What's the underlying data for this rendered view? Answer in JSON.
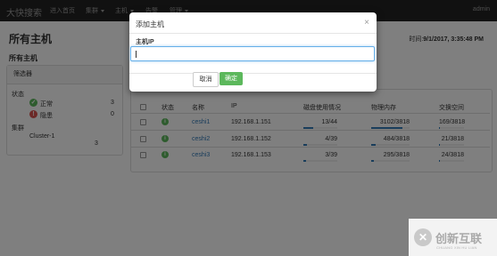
{
  "navbar": {
    "brand": "大快搜索",
    "items": [
      {
        "label": "进入首页",
        "dropdown": false
      },
      {
        "label": "集群",
        "dropdown": true
      },
      {
        "label": "主机",
        "dropdown": true
      },
      {
        "label": "告警",
        "dropdown": false
      },
      {
        "label": "管理",
        "dropdown": true
      }
    ],
    "user": "admin"
  },
  "page": {
    "title": "所有主机",
    "time_label": "时间:",
    "time_value": "9/1/2017, 3:35:48 PM",
    "subtitle": "所有主机"
  },
  "filter": {
    "header": "筛选器",
    "status_label": "状态",
    "statuses": [
      {
        "label": "正常",
        "count": "3",
        "icon": "check-icon",
        "color": "#5cb85c"
      },
      {
        "label": "隐患",
        "count": "0",
        "icon": "alert-icon",
        "color": "#d9534f"
      }
    ],
    "cluster_label": "集群",
    "cluster_name": "Cluster-1",
    "cluster_count": "3"
  },
  "hosts": {
    "columns": [
      "状态",
      "名称",
      "IP",
      "磁盘使用情况",
      "物理内存",
      "交换空间"
    ],
    "rows": [
      {
        "name": "ceshi1",
        "ip": "192.168.1.151",
        "disk": "13/44",
        "disk_pct": 0.295,
        "mem": "3102/3818",
        "mem_pct": 0.812,
        "swap": "169/3818",
        "swap_pct": 0.044
      },
      {
        "name": "ceshi2",
        "ip": "192.168.1.152",
        "disk": "4/39",
        "disk_pct": 0.103,
        "mem": "484/3818",
        "mem_pct": 0.127,
        "swap": "21/3818",
        "swap_pct": 0.006
      },
      {
        "name": "ceshi3",
        "ip": "192.168.1.153",
        "disk": "3/39",
        "disk_pct": 0.077,
        "mem": "295/3818",
        "mem_pct": 0.077,
        "swap": "24/3818",
        "swap_pct": 0.006
      }
    ]
  },
  "modal": {
    "title": "添加主机",
    "close": "×",
    "field_label": "主机IP",
    "input_value": "",
    "cancel_label": "取消",
    "confirm_label": "确定"
  },
  "watermark": {
    "logo_glyph": "✕",
    "text": "创新互联",
    "sub": "CHUANG XIN HU LIAN"
  }
}
